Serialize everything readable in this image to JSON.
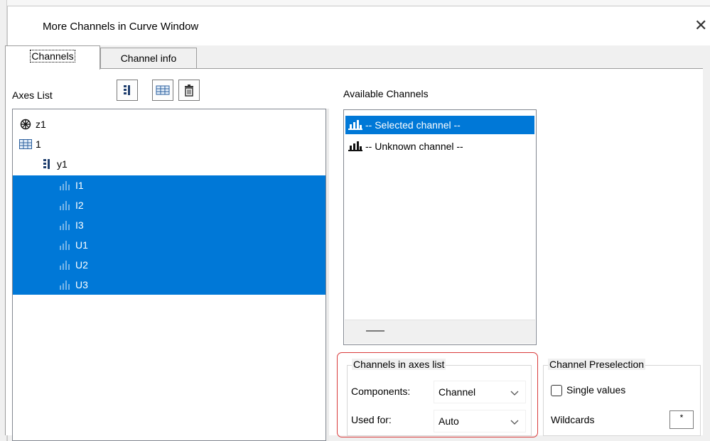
{
  "window": {
    "title": "More Channels in Curve Window",
    "close_glyph": "✕"
  },
  "tabs": [
    {
      "label": "Channels",
      "active": true
    },
    {
      "label": "Channel info",
      "active": false
    }
  ],
  "axes_list": {
    "label": "Axes List",
    "toolbar": [
      "add-y-axis-icon",
      "add-grid-icon",
      "delete-icon"
    ],
    "items": [
      {
        "label": "z1",
        "icon": "z-axis-icon",
        "selected": false
      },
      {
        "label": "1",
        "icon": "grid-icon",
        "selected": false
      },
      {
        "label": "y1",
        "icon": "y-axis-icon",
        "selected": false
      },
      {
        "label": "I1",
        "icon": "channel-icon",
        "selected": true
      },
      {
        "label": "I2",
        "icon": "channel-icon",
        "selected": true
      },
      {
        "label": "I3",
        "icon": "channel-icon",
        "selected": true
      },
      {
        "label": "U1",
        "icon": "channel-icon",
        "selected": true
      },
      {
        "label": "U2",
        "icon": "channel-icon",
        "selected": true
      },
      {
        "label": "U3",
        "icon": "channel-icon",
        "selected": true
      }
    ]
  },
  "available": {
    "label": "Available Channels",
    "items": [
      {
        "label": "-- Selected channel --",
        "selected": true
      },
      {
        "label": "-- Unknown channel --",
        "selected": false
      }
    ]
  },
  "channels_in_axes": {
    "title": "Channels in axes list",
    "components_label": "Components:",
    "components_value": "Channel",
    "used_for_label": "Used for:",
    "used_for_value": "Auto"
  },
  "preselection": {
    "title": "Channel Preselection",
    "single_values_label": "Single values",
    "single_values_checked": false,
    "wildcards_label": "Wildcards",
    "wildcards_value": "*"
  },
  "colors": {
    "selection": "#0078d7",
    "highlight_frame": "#d93b3b"
  }
}
